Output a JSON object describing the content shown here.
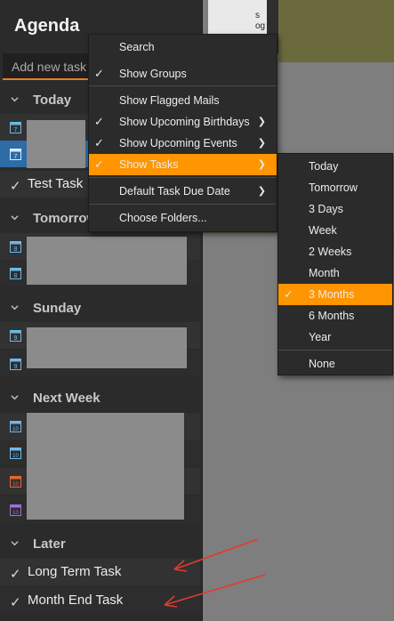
{
  "panel": {
    "title": "Agenda",
    "add_task_placeholder": "Add new task",
    "groups": {
      "today": "Today",
      "tomorrow": "Tomorrow",
      "sunday": "Sunday",
      "next_week": "Next Week",
      "later": "Later"
    },
    "today_task": "Test Task",
    "later_tasks": [
      "Long Term Task",
      "Month End Task"
    ],
    "calendar_days": {
      "today": "7",
      "tomorrow": "8",
      "sunday": "9",
      "next_week": "10"
    }
  },
  "context_menu": {
    "items": [
      {
        "label": "Search",
        "checked": false,
        "submenu": false
      },
      {
        "label": "Show Groups",
        "checked": true,
        "submenu": false
      },
      {
        "label": "Show Flagged Mails",
        "checked": false,
        "submenu": false
      },
      {
        "label": "Show Upcoming Birthdays",
        "checked": true,
        "submenu": true
      },
      {
        "label": "Show Upcoming Events",
        "checked": true,
        "submenu": true
      },
      {
        "label": "Show Tasks",
        "checked": true,
        "submenu": true,
        "highlighted": true
      },
      {
        "label": "Default Task Due Date",
        "checked": false,
        "submenu": true
      },
      {
        "label": "Choose Folders...",
        "checked": false,
        "submenu": false
      }
    ]
  },
  "tasks_submenu": {
    "items": [
      {
        "label": "Today"
      },
      {
        "label": "Tomorrow"
      },
      {
        "label": "3 Days"
      },
      {
        "label": "Week"
      },
      {
        "label": "2 Weeks"
      },
      {
        "label": "Month"
      },
      {
        "label": "3 Months",
        "checked": true,
        "highlighted": true
      },
      {
        "label": "6 Months"
      },
      {
        "label": "Year"
      },
      {
        "label": "None"
      }
    ]
  },
  "background": {
    "fragment_text": "s\nog"
  },
  "colors": {
    "accent": "#ff9500",
    "selection": "#2d6ca7",
    "annotation_arrow": "#e23b2b",
    "panel_bg": "#2b2b2b"
  }
}
